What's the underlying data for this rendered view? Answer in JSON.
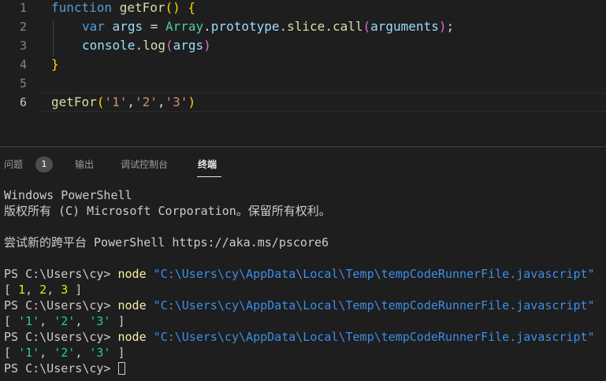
{
  "editor": {
    "line_numbers": [
      "1",
      "2",
      "3",
      "4",
      "5",
      "6"
    ],
    "code": {
      "l1_keyword": "function",
      "l1_name": "getFor",
      "l1_parens": "()",
      "l1_brace": "{",
      "l2_keyword": "var",
      "l2_var": "args",
      "l2_eq": " = ",
      "l2_class": "Array",
      "l2_dot1": ".",
      "l2_proto": "prototype",
      "l2_dot2": ".",
      "l2_slice": "slice",
      "l2_dot3": ".",
      "l2_call": "call",
      "l2_open": "(",
      "l2_arg": "arguments",
      "l2_close": ")",
      "l2_semi": ";",
      "l3_console": "console",
      "l3_dot": ".",
      "l3_log": "log",
      "l3_open": "(",
      "l3_arg": "args",
      "l3_close": ")",
      "l4_brace": "}",
      "l6_name": "getFor",
      "l6_open": "(",
      "l6_a1": "'1'",
      "l6_c1": ",",
      "l6_a2": "'2'",
      "l6_c2": ",",
      "l6_a3": "'3'",
      "l6_close": ")"
    }
  },
  "panel": {
    "tabs": {
      "problems": "问题",
      "problems_count": "1",
      "output": "输出",
      "debug_console": "调试控制台",
      "terminal": "终端"
    },
    "terminal": {
      "banner1": "Windows PowerShell",
      "banner2": "版权所有 (C) Microsoft Corporation。保留所有权利。",
      "banner3": "尝试新的跨平台 PowerShell https://aka.ms/pscore6",
      "prompt": "PS C:\\Users\\cy> ",
      "cmd": "node",
      "path": "\"C:\\Users\\cy\\AppData\\Local\\Temp\\tempCodeRunnerFile.javascript\"",
      "out1_open": "[ ",
      "out1_n1": "1",
      "out1_n2": "2",
      "out1_n3": "3",
      "out1_close": " ]",
      "sep": ", ",
      "s1": "'1'",
      "s2": "'2'",
      "s3": "'3'"
    }
  }
}
